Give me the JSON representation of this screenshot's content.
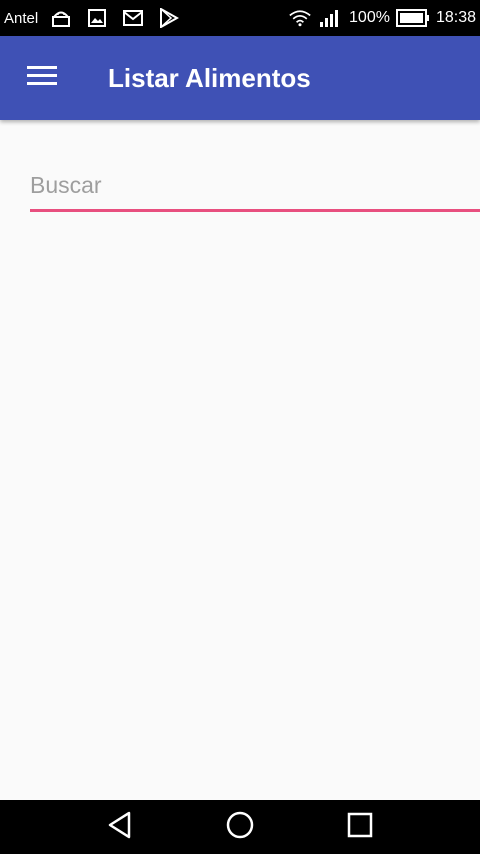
{
  "status_bar": {
    "carrier": "Antel",
    "notification_icons": [
      "android-debug-icon",
      "image-icon",
      "mail-icon",
      "play-store-icon"
    ],
    "battery_percent": "100%",
    "time": "18:38"
  },
  "app_bar": {
    "title": "Listar Alimentos",
    "color": "#3f51b5"
  },
  "search": {
    "placeholder": "Buscar",
    "value": "",
    "accent_color": "#e84f7f"
  },
  "nav_bar": {
    "buttons": [
      "back-icon",
      "home-icon",
      "recents-icon"
    ]
  }
}
